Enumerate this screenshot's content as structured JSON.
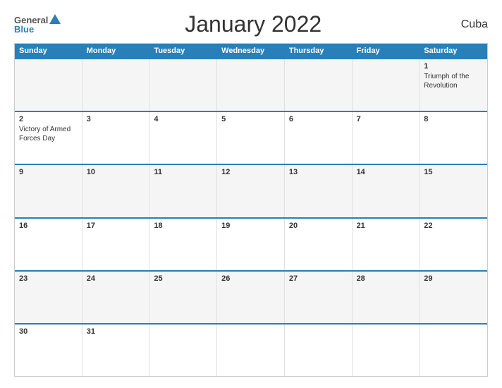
{
  "header": {
    "title": "January 2022",
    "country": "Cuba",
    "logo": {
      "general": "General",
      "blue": "Blue"
    }
  },
  "days": [
    "Sunday",
    "Monday",
    "Tuesday",
    "Wednesday",
    "Thursday",
    "Friday",
    "Saturday"
  ],
  "weeks": [
    [
      {
        "day": "",
        "empty": true
      },
      {
        "day": "",
        "empty": true
      },
      {
        "day": "",
        "empty": true
      },
      {
        "day": "",
        "empty": true
      },
      {
        "day": "",
        "empty": true
      },
      {
        "day": "",
        "empty": true
      },
      {
        "day": "1",
        "holiday": "Triumph of the Revolution",
        "empty": false
      }
    ],
    [
      {
        "day": "2",
        "holiday": "Victory of Armed Forces Day",
        "empty": false
      },
      {
        "day": "3",
        "holiday": "",
        "empty": false
      },
      {
        "day": "4",
        "holiday": "",
        "empty": false
      },
      {
        "day": "5",
        "holiday": "",
        "empty": false
      },
      {
        "day": "6",
        "holiday": "",
        "empty": false
      },
      {
        "day": "7",
        "holiday": "",
        "empty": false
      },
      {
        "day": "8",
        "holiday": "",
        "empty": false
      }
    ],
    [
      {
        "day": "9",
        "holiday": "",
        "empty": false
      },
      {
        "day": "10",
        "holiday": "",
        "empty": false
      },
      {
        "day": "11",
        "holiday": "",
        "empty": false
      },
      {
        "day": "12",
        "holiday": "",
        "empty": false
      },
      {
        "day": "13",
        "holiday": "",
        "empty": false
      },
      {
        "day": "14",
        "holiday": "",
        "empty": false
      },
      {
        "day": "15",
        "holiday": "",
        "empty": false
      }
    ],
    [
      {
        "day": "16",
        "holiday": "",
        "empty": false
      },
      {
        "day": "17",
        "holiday": "",
        "empty": false
      },
      {
        "day": "18",
        "holiday": "",
        "empty": false
      },
      {
        "day": "19",
        "holiday": "",
        "empty": false
      },
      {
        "day": "20",
        "holiday": "",
        "empty": false
      },
      {
        "day": "21",
        "holiday": "",
        "empty": false
      },
      {
        "day": "22",
        "holiday": "",
        "empty": false
      }
    ],
    [
      {
        "day": "23",
        "holiday": "",
        "empty": false
      },
      {
        "day": "24",
        "holiday": "",
        "empty": false
      },
      {
        "day": "25",
        "holiday": "",
        "empty": false
      },
      {
        "day": "26",
        "holiday": "",
        "empty": false
      },
      {
        "day": "27",
        "holiday": "",
        "empty": false
      },
      {
        "day": "28",
        "holiday": "",
        "empty": false
      },
      {
        "day": "29",
        "holiday": "",
        "empty": false
      }
    ],
    [
      {
        "day": "30",
        "holiday": "",
        "empty": false
      },
      {
        "day": "31",
        "holiday": "",
        "empty": false
      },
      {
        "day": "",
        "empty": true
      },
      {
        "day": "",
        "empty": true
      },
      {
        "day": "",
        "empty": true
      },
      {
        "day": "",
        "empty": true
      },
      {
        "day": "",
        "empty": true
      }
    ]
  ],
  "colors": {
    "header_bg": "#2980b9",
    "header_text": "#ffffff",
    "accent": "#2980b9"
  }
}
